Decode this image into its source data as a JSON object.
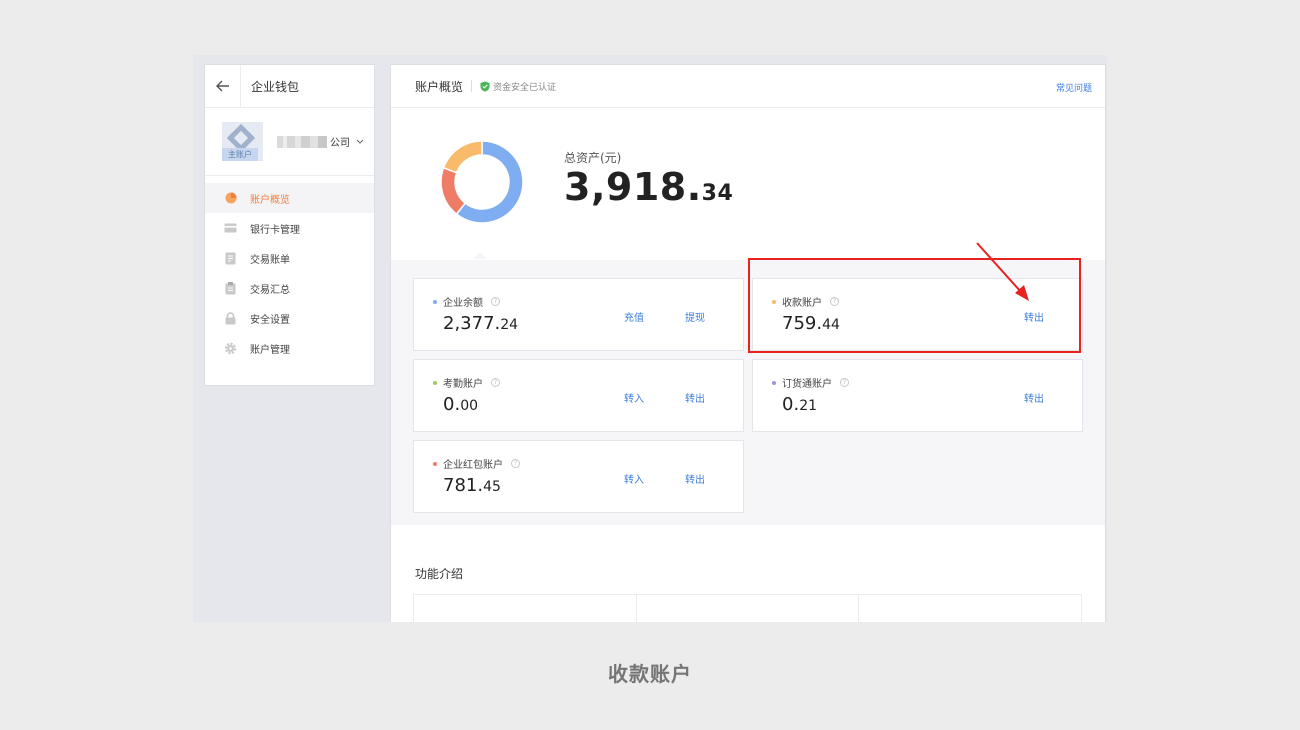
{
  "sidebar": {
    "title": "企业钱包",
    "company_suffix": "公司",
    "account_badge": "主账户",
    "items": [
      {
        "label": "账户概览",
        "icon": "pie-chart-icon",
        "active": true
      },
      {
        "label": "银行卡管理",
        "icon": "card-icon"
      },
      {
        "label": "交易账单",
        "icon": "document-icon"
      },
      {
        "label": "交易汇总",
        "icon": "clipboard-icon"
      },
      {
        "label": "安全设置",
        "icon": "lock-icon"
      },
      {
        "label": "账户管理",
        "icon": "gear-icon"
      }
    ]
  },
  "header": {
    "title": "账户概览",
    "secure_text": "资金安全已认证",
    "faq_label": "常见问题"
  },
  "overview": {
    "total_label": "总资产(元)",
    "total_int": "3,918.",
    "total_dec": "34",
    "donut": [
      {
        "name": "企业余额",
        "value": 2377.24,
        "color": "#7eaef1"
      },
      {
        "name": "企业红包账户",
        "value": 781.45,
        "color": "#ef7d66"
      },
      {
        "name": "收款账户",
        "value": 759.44,
        "color": "#f9bb6b"
      }
    ]
  },
  "accounts": [
    {
      "label": "企业余额",
      "int": "2,377.",
      "dec": "24",
      "dot": "#7eaef1",
      "actions": [
        "充值",
        "提现"
      ]
    },
    {
      "label": "收款账户",
      "int": "759.",
      "dec": "44",
      "dot": "#f9bb6b",
      "actions": [
        "转出"
      ]
    },
    {
      "label": "考勤账户",
      "int": "0.",
      "dec": "00",
      "dot": "#9ac96a",
      "actions": [
        "转入",
        "转出"
      ]
    },
    {
      "label": "订货通账户",
      "int": "0.",
      "dec": "21",
      "dot": "#9b93e6",
      "actions": [
        "转出"
      ]
    },
    {
      "label": "企业红包账户",
      "int": "781.",
      "dec": "45",
      "dot": "#ef7d66",
      "actions": [
        "转入",
        "转出"
      ]
    }
  ],
  "functions": {
    "title": "功能介绍"
  },
  "caption": "收款账户"
}
